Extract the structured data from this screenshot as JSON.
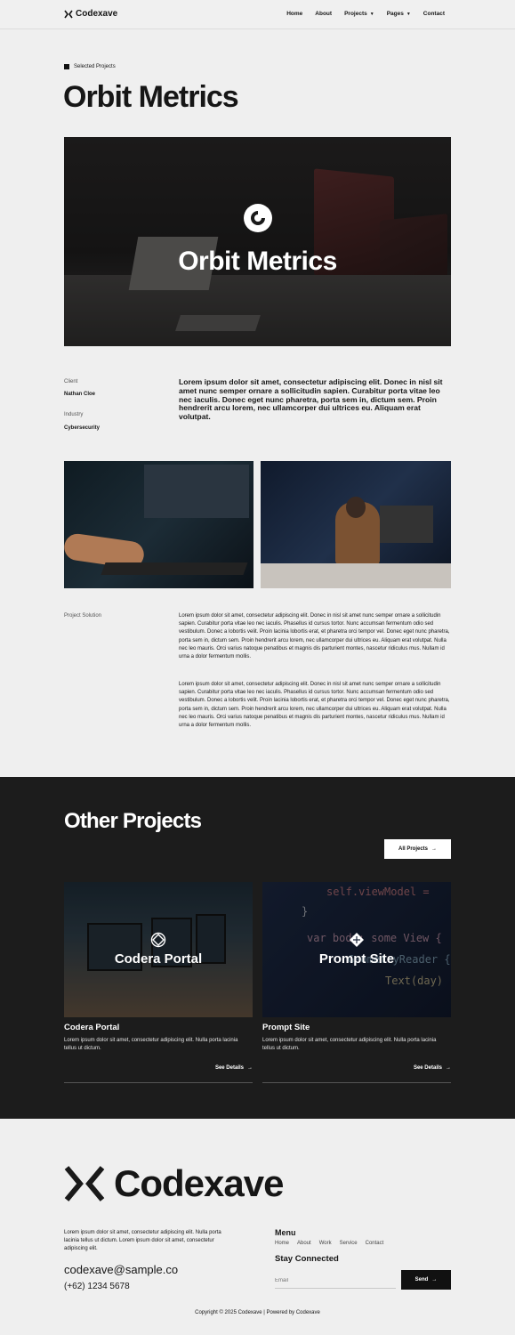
{
  "nav": {
    "brand": "Codexave",
    "items": [
      {
        "label": "Home",
        "dropdown": false
      },
      {
        "label": "About",
        "dropdown": false
      },
      {
        "label": "Projects",
        "dropdown": true
      },
      {
        "label": "Pages",
        "dropdown": true
      },
      {
        "label": "Contact",
        "dropdown": false
      }
    ]
  },
  "hero": {
    "eyebrow": "Selected Projects",
    "title": "Orbit Metrics",
    "image_brand": "Orbit Metrics"
  },
  "meta": {
    "client_label": "Client",
    "client_value": "Nathan Cloe",
    "industry_label": "Industry",
    "industry_value": "Cybersecurity",
    "lead": "Lorem ipsum dolor sit amet, consectetur adipiscing elit. Donec in nisl sit amet nunc semper ornare a sollicitudin sapien. Curabitur porta vitae leo nec iaculis. Donec eget nunc pharetra, porta sem in, dictum sem. Proin hendrerit arcu lorem, nec ullamcorper dui ultrices eu. Aliquam erat volutpat."
  },
  "solution": {
    "label": "Project Solution",
    "paragraphs": [
      "Lorem ipsum dolor sit amet, consectetur adipiscing elit. Donec in nisl sit amet nunc semper ornare a sollicitudin sapien. Curabitur porta vitae leo nec iaculis. Phasellus id cursus tortor. Nunc accumsan fermentum odio sed vestibulum. Donec a lobortis velit. Proin lacinia lobortis erat, et pharetra orci tempor vel. Donec eget nunc pharetra, porta sem in, dictum sem. Proin hendrerit arcu lorem, nec ullamcorper dui ultrices eu. Aliquam erat volutpat. Nulla nec leo mauris. Orci varius natoque penatibus et magnis dis parturient montes, nascetur ridiculus mus. Nullam id urna a dolor fermentum mollis.",
      "Lorem ipsum dolor sit amet, consectetur adipiscing elit. Donec in nisl sit amet nunc semper ornare a sollicitudin sapien. Curabitur porta vitae leo nec iaculis. Phasellus id cursus tortor. Nunc accumsan fermentum odio sed vestibulum. Donec a lobortis velit. Proin lacinia lobortis erat, et pharetra orci tempor vel. Donec eget nunc pharetra, porta sem in, dictum sem. Proin hendrerit arcu lorem, nec ullamcorper dui ultrices eu. Aliquam erat volutpat. Nulla nec leo mauris. Orci varius natoque penatibus et magnis dis parturient montes, nascetur ridiculus mus. Nullam id urna a dolor fermentum mollis."
    ]
  },
  "other": {
    "title": "Other Projects",
    "all_button": "All Projects",
    "cards": [
      {
        "image_brand": "Codera Portal",
        "title": "Codera Portal",
        "desc": "Lorem ipsum dolor sit amet, consectetur adipiscing elit. Nulla porta lacinia tellus ut dictum.",
        "cta": "See Details"
      },
      {
        "image_brand": "Prompt Site",
        "title": "Prompt Site",
        "desc": "Lorem ipsum dolor sit amet, consectetur adipiscing elit. Nulla porta lacinia tellus ut dictum.",
        "cta": "See Details"
      }
    ],
    "code_lines": [
      "self.viewModel =",
      "}",
      "var body: some View {",
      "GeometryReader {",
      "Text(day)"
    ]
  },
  "footer": {
    "brand": "Codexave",
    "desc": "Lorem ipsum dolor sit amet, consectetur adipiscing elit. Nulla porta lacinia tellus ut dictum. Lorem ipsum dolor sit amet, consectetur adipiscing elit.",
    "email": "codexave@sample.co",
    "phone": "(+62) 1234 5678",
    "menu_title": "Menu",
    "links": [
      "Home",
      "About",
      "Work",
      "Service",
      "Contact"
    ],
    "stay_title": "Stay Connected",
    "email_placeholder": "Email",
    "send": "Send",
    "copyright": "Copyright © 2025 Codexave | Powered by Codexave"
  },
  "colors": {
    "dark": "#1c1c1c",
    "light": "#efefef",
    "accent": "#111111"
  }
}
